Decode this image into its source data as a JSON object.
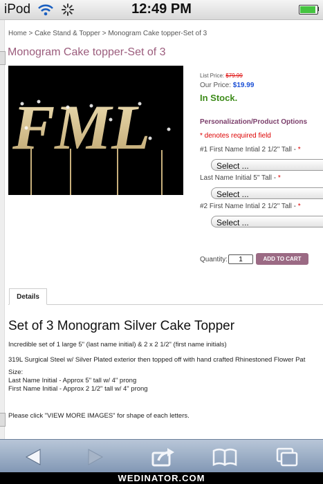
{
  "status_bar": {
    "carrier": "iPod",
    "time": "12:49 PM",
    "battery_level": 0.9
  },
  "breadcrumb": "Home > Cake Stand & Topper > Monogram Cake topper-Set of 3",
  "product": {
    "title": "Monogram Cake topper-Set of 3",
    "image_letters": "FML",
    "list_price_label": "List Price:",
    "list_price": "$79.99",
    "our_price_label": "Our Price:",
    "our_price": "$19.99",
    "stock_status": "In Stock."
  },
  "options": {
    "heading": "Personalization/Product Options",
    "required_note": "* denotes required field",
    "fields": [
      {
        "label": "#1 First Name Intial 2 1/2\" Tall - ",
        "required": "*",
        "value": "Select ..."
      },
      {
        "label": "Last Name Initial 5\" Tall - ",
        "required": "*",
        "value": "Select ..."
      },
      {
        "label": "#2 First Name Intial 2 1/2\" Tall - ",
        "required": "*",
        "value": "Select ..."
      }
    ]
  },
  "quantity": {
    "label": "Quantity:",
    "value": "1"
  },
  "add_to_cart_label": "ADD TO CART",
  "tabs": {
    "details": "Details"
  },
  "description": {
    "title": "Set of 3 Monogram Silver Cake Topper",
    "lines": [
      "Incredible set of 1 large 5\" (last name initial) & 2 x 2 1/2\" (first name initials)",
      "319L Surgical Steel w/ Silver Plated exterior then topped off with hand crafted Rhinestoned Flower Pat",
      "Size:",
      "Last Name Initial - Approx 5\" tall w/ 4\" prong",
      "First Name Initial - Approx 2 1/2\" tall w/ 4\" prong",
      "Please click \"VIEW MORE IMAGES\" for shape of each letters."
    ]
  },
  "toolbar_icons": [
    "back-arrow-icon",
    "forward-arrow-icon",
    "share-icon",
    "bookmarks-icon",
    "tabs-icon"
  ],
  "watermark": "WEDINATOR.COM",
  "colors": {
    "title": "#9b5c7c",
    "price": "#1a4fd6",
    "stock": "#3d8b1a",
    "required": "#dd0000",
    "button": "#9b6a84"
  }
}
